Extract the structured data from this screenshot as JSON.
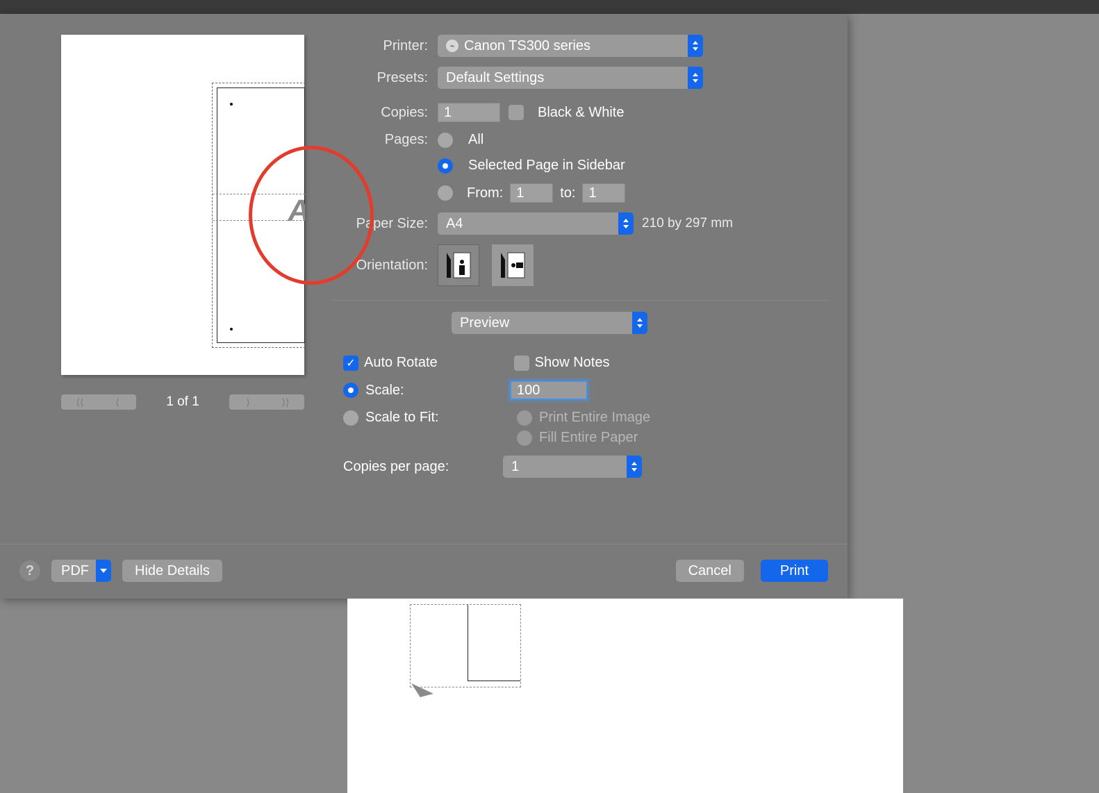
{
  "labels": {
    "printer": "Printer:",
    "presets": "Presets:",
    "copies": "Copies:",
    "bw": "Black & White",
    "pages": "Pages:",
    "all": "All",
    "selected_page": "Selected Page in Sidebar",
    "from": "From:",
    "to": "to:",
    "paper_size": "Paper Size:",
    "paper_dim": "210 by 297 mm",
    "orientation": "Orientation:",
    "section": "Preview",
    "auto_rotate": "Auto Rotate",
    "show_notes": "Show Notes",
    "scale": "Scale:",
    "scale_fit": "Scale to Fit:",
    "print_entire": "Print Entire Image",
    "fill_paper": "Fill Entire Paper",
    "copies_per_page": "Copies per page:"
  },
  "values": {
    "printer": "Canon TS300 series",
    "preset": "Default Settings",
    "copies": "1",
    "from": "1",
    "to": "1",
    "paper_size": "A4",
    "scale": "100",
    "copies_per_page": "1",
    "page_indicator": "1 of 1"
  },
  "footer": {
    "pdf": "PDF",
    "hide_details": "Hide Details",
    "cancel": "Cancel",
    "print": "Print",
    "help": "?"
  }
}
